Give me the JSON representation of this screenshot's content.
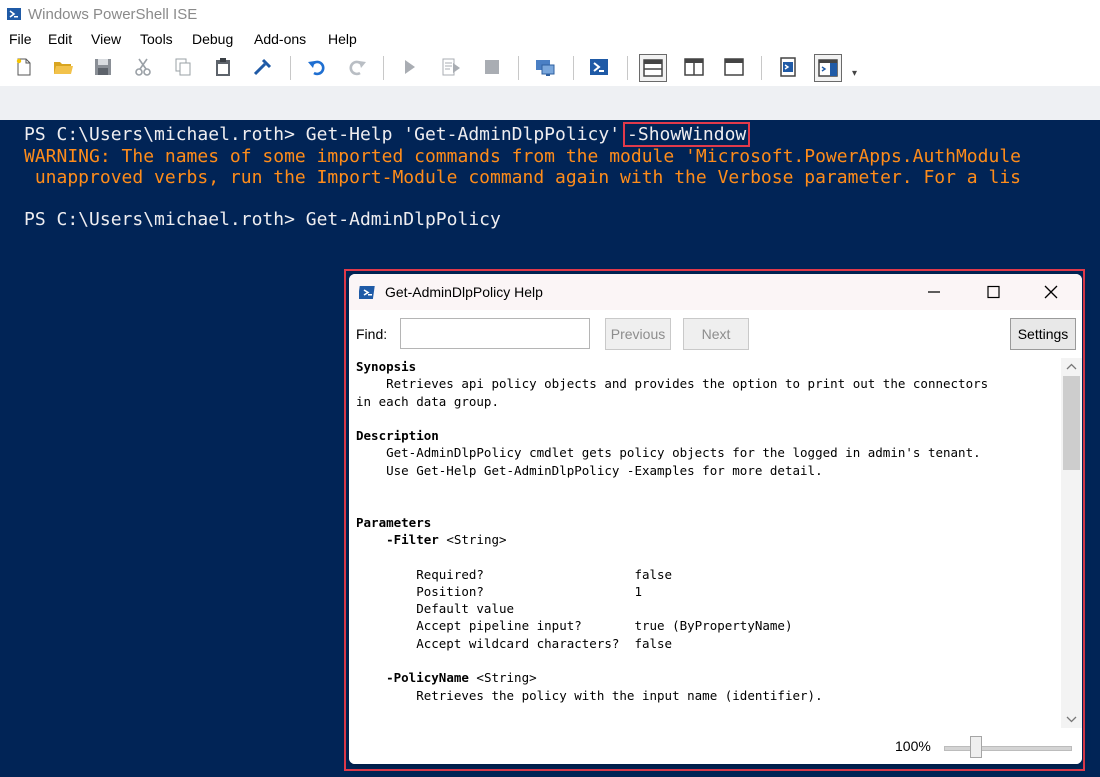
{
  "window": {
    "title": "Windows PowerShell ISE"
  },
  "menu": [
    "File",
    "Edit",
    "View",
    "Tools",
    "Debug",
    "Add-ons",
    "Help"
  ],
  "toolbar_icons": [
    "new-file-icon",
    "open-folder-icon",
    "save-icon",
    "cut-icon",
    "copy-icon",
    "paste-icon",
    "clear-icon",
    "undo-icon",
    "redo-icon",
    "run-icon",
    "run-selection-icon",
    "stop-icon",
    "remote-icon",
    "powershell-console-icon",
    "layout-top-icon",
    "layout-right-icon",
    "layout-max-icon",
    "show-commands-icon",
    "show-addons-icon"
  ],
  "console": {
    "line1_prompt": "PS C:\\Users\\michael.roth> ",
    "line1_command": "Get-Help 'Get-AdminDlpPolicy'",
    "line1_highlight": "-ShowWindow",
    "warning1": "WARNING: The names of some imported commands from the module 'Microsoft.PowerApps.AuthModule",
    "warning2": " unapproved verbs, run the Import-Module command again with the Verbose parameter. For a lis",
    "line2": "PS C:\\Users\\michael.roth> Get-AdminDlpPolicy"
  },
  "help_window": {
    "title": "Get-AdminDlpPolicy Help",
    "find_label": "Find:",
    "find_value": "",
    "previous_label": "Previous",
    "next_label": "Next",
    "settings_label": "Settings",
    "zoom": "100%",
    "zoom_level": 0.25,
    "lines": [
      {
        "text": "Synopsis",
        "bold": true
      },
      {
        "text": "    Retrieves api policy objects and provides the option to print out the connectors"
      },
      {
        "text": "in each data group."
      },
      {
        "text": ""
      },
      {
        "text": "Description",
        "bold": true
      },
      {
        "text": "    Get-AdminDlpPolicy cmdlet gets policy objects for the logged in admin's tenant."
      },
      {
        "text": "    Use Get-Help Get-AdminDlpPolicy -Examples for more detail."
      },
      {
        "text": ""
      },
      {
        "text": ""
      },
      {
        "text": "Parameters",
        "bold": true
      },
      {
        "text": "",
        "param": "-Filter",
        "rest": " <String>"
      },
      {
        "text": ""
      },
      {
        "text": "        Required?                    false"
      },
      {
        "text": "        Position?                    1"
      },
      {
        "text": "        Default value"
      },
      {
        "text": "        Accept pipeline input?       true (ByPropertyName)"
      },
      {
        "text": "        Accept wildcard characters?  false"
      },
      {
        "text": ""
      },
      {
        "text": "",
        "param": "-PolicyName",
        "rest": " <String>"
      },
      {
        "text": "        Retrieves the policy with the input name (identifier)."
      }
    ]
  },
  "colors": {
    "console_bg": "#012456",
    "console_text": "#eeedf0",
    "warning_text": "#ff8c1a",
    "highlight_border": "#e23a4b"
  }
}
